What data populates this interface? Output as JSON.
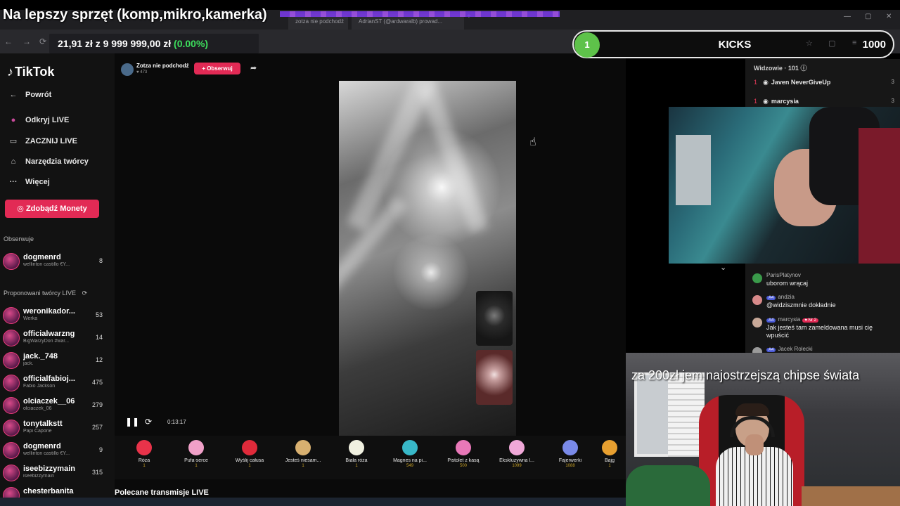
{
  "overlay": {
    "goal_title": "Na lepszy sprzęt (komp,mikro,kamerka)",
    "tip_raised": "21,91 zł",
    "tip_sep": "z",
    "tip_target": "9 999 999,00 zł",
    "tip_pct": "(0.00%)",
    "kicks_rank": "1",
    "kicks_label": "KICKS",
    "kicks_count": "1000",
    "webcam_caption": "za 200zł jem najostrzejszą chipse świata"
  },
  "browser": {
    "tabs": [
      "zotza nie podchodź",
      "AdrianST (@ardwaralb) prowad..."
    ]
  },
  "sidebar": {
    "logo": "TikTok",
    "nav": [
      {
        "icon": "back-arrow-icon",
        "glyph": "←",
        "label": "Powrót"
      },
      {
        "icon": "discover-live-icon",
        "glyph": "●",
        "label": "Odkryj LIVE"
      },
      {
        "icon": "camera-icon",
        "glyph": "▭",
        "label": "ZACZNIJ LIVE"
      },
      {
        "icon": "home-icon",
        "glyph": "⌂",
        "label": "Narzędzia twórcy"
      },
      {
        "icon": "more-icon",
        "glyph": "···",
        "label": "Więcej"
      }
    ],
    "coins_button": "Zdobądź Monety",
    "following_label": "Obserwuje",
    "following": [
      {
        "name": "dogmenrd",
        "sub": "wellinton castillo €Y...",
        "count": "8"
      }
    ],
    "suggested_label": "Proponowani twórcy LIVE",
    "suggested": [
      {
        "name": "weronikador...",
        "sub": "Werka",
        "count": "53"
      },
      {
        "name": "officialwarzng",
        "sub": "BigWarzyDon #war...",
        "count": "14"
      },
      {
        "name": "jack._748",
        "sub": "jack.",
        "count": "12"
      },
      {
        "name": "officialfabioj...",
        "sub": "Fabio Jackson",
        "count": "475"
      },
      {
        "name": "olciaczek__06",
        "sub": "olciaczek_06",
        "count": "279"
      },
      {
        "name": "tonytalkstt",
        "sub": "Papi Capone",
        "count": "257"
      },
      {
        "name": "dogmenrd",
        "sub": "wellinton castillo €Y...",
        "count": "9"
      },
      {
        "name": "iseebizzymain",
        "sub": "iseebizzymain",
        "count": "315"
      },
      {
        "name": "chesterbanita",
        "sub": "",
        "count": ""
      }
    ]
  },
  "live": {
    "host_name": "Zotza nie podchodź",
    "host_likes": "♥ 473",
    "follow_button": "+ Obserwuj",
    "timer": "0:13:17",
    "recommended": "Polecane transmisje LIVE"
  },
  "gifts": [
    {
      "name": "Róża",
      "price": "1",
      "color": "#e8334a"
    },
    {
      "name": "Pufa-serce",
      "price": "1",
      "color": "#f0a0c8"
    },
    {
      "name": "Wyślij całusa",
      "price": "1",
      "color": "#e02a3a"
    },
    {
      "name": "Jesteś niesam...",
      "price": "1",
      "color": "#d8b070"
    },
    {
      "name": "Biała róża",
      "price": "1",
      "color": "#f0f0e0"
    },
    {
      "name": "Magnes na pi...",
      "price": "549",
      "color": "#38b8c8"
    },
    {
      "name": "Pistolet z kasą",
      "price": "500",
      "color": "#e878b8"
    },
    {
      "name": "Ekskluzywna l...",
      "price": "1099",
      "color": "#f0a8d8"
    },
    {
      "name": "Fajerwerki",
      "price": "1088",
      "color": "#7a8ae8"
    },
    {
      "name": "Bajg",
      "price": "1",
      "color": "#e8a030"
    }
  ],
  "viewers": {
    "header": "Widzowie · 101",
    "rows": [
      {
        "rank": "1",
        "name": "Javen NeverGiveUp"
      },
      {
        "rank": "1",
        "name": "marcysia"
      }
    ]
  },
  "chat": [
    {
      "user": "ParisPlatynov",
      "level": "",
      "badge": "",
      "text": "uborom wrącaj",
      "color": "#3a9a4a"
    },
    {
      "user": "andzia",
      "level": "A4",
      "badge": "",
      "text": "@widziszmnie dokładnie",
      "color": "#d88a8a"
    },
    {
      "user": "marcysia",
      "level": "A4",
      "badge": "♥ Nr 2",
      "text": "Jak jesteś tam zameldowana musi cię wpuścić",
      "color": "#c8a898"
    },
    {
      "user": "Jacek Rolecki",
      "level": "A4",
      "badge": "",
      "text": "",
      "color": "#9a9a9a"
    }
  ]
}
